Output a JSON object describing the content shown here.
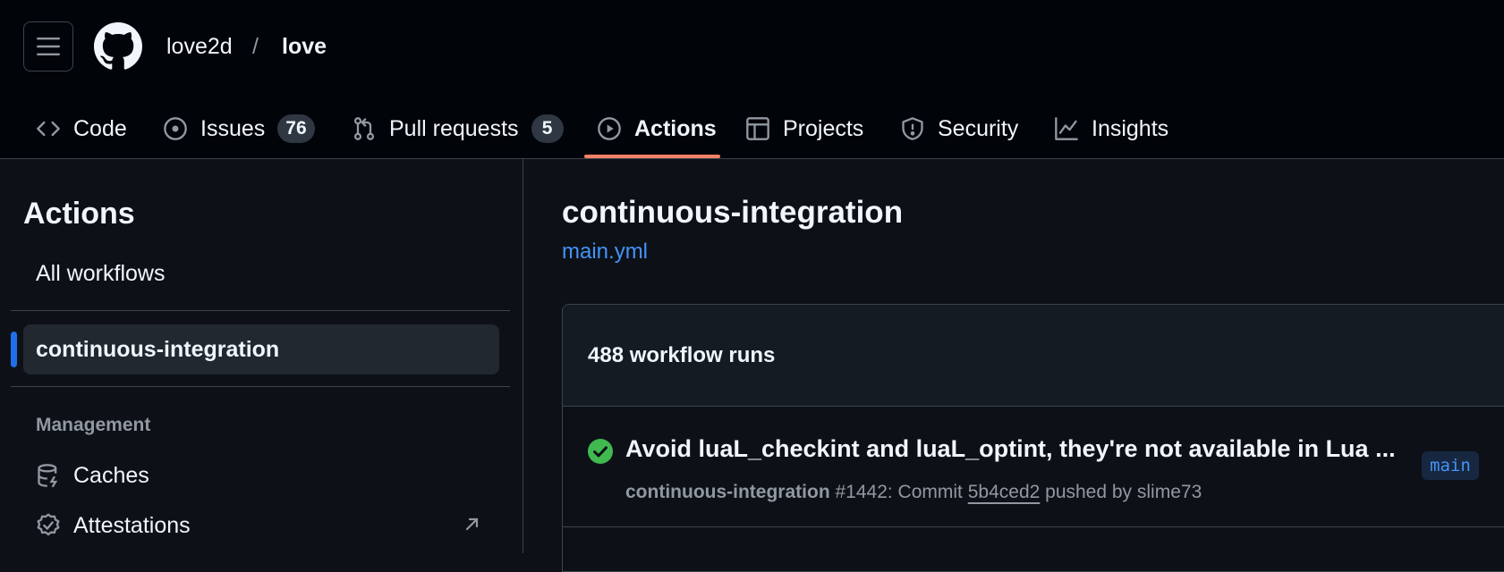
{
  "header": {
    "owner": "love2d",
    "separator": "/",
    "repo": "love"
  },
  "nav": {
    "tabs": [
      {
        "label": "Code",
        "icon": "code-icon"
      },
      {
        "label": "Issues",
        "icon": "issue-opened-icon",
        "count": "76"
      },
      {
        "label": "Pull requests",
        "icon": "git-pull-request-icon",
        "count": "5"
      },
      {
        "label": "Actions",
        "icon": "play-icon",
        "selected": true
      },
      {
        "label": "Projects",
        "icon": "table-icon"
      },
      {
        "label": "Security",
        "icon": "shield-icon"
      },
      {
        "label": "Insights",
        "icon": "graph-icon"
      }
    ],
    "active_color": "#f78166"
  },
  "sidebar": {
    "title": "Actions",
    "all_workflows": "All workflows",
    "selected_workflow": "continuous-integration",
    "management_heading": "Management",
    "items": [
      {
        "label": "Caches",
        "icon": "database-icon"
      },
      {
        "label": "Attestations",
        "icon": "verified-icon"
      }
    ],
    "accent": "#1f6feb"
  },
  "main": {
    "workflow_title": "continuous-integration",
    "workflow_file": "main.yml",
    "runs_count": "488 workflow runs",
    "runs": [
      {
        "status": "success",
        "title": "Avoid luaL_checkint and luaL_optint, they're not available in Lua ...",
        "workflow": "continuous-integration",
        "meta_prefix": " #1442: Commit ",
        "commit": "5b4ced2",
        "meta_suffix": " pushed by slime73",
        "branch": "main"
      }
    ],
    "success_color": "#3fb950",
    "link_color": "#4493f8"
  }
}
